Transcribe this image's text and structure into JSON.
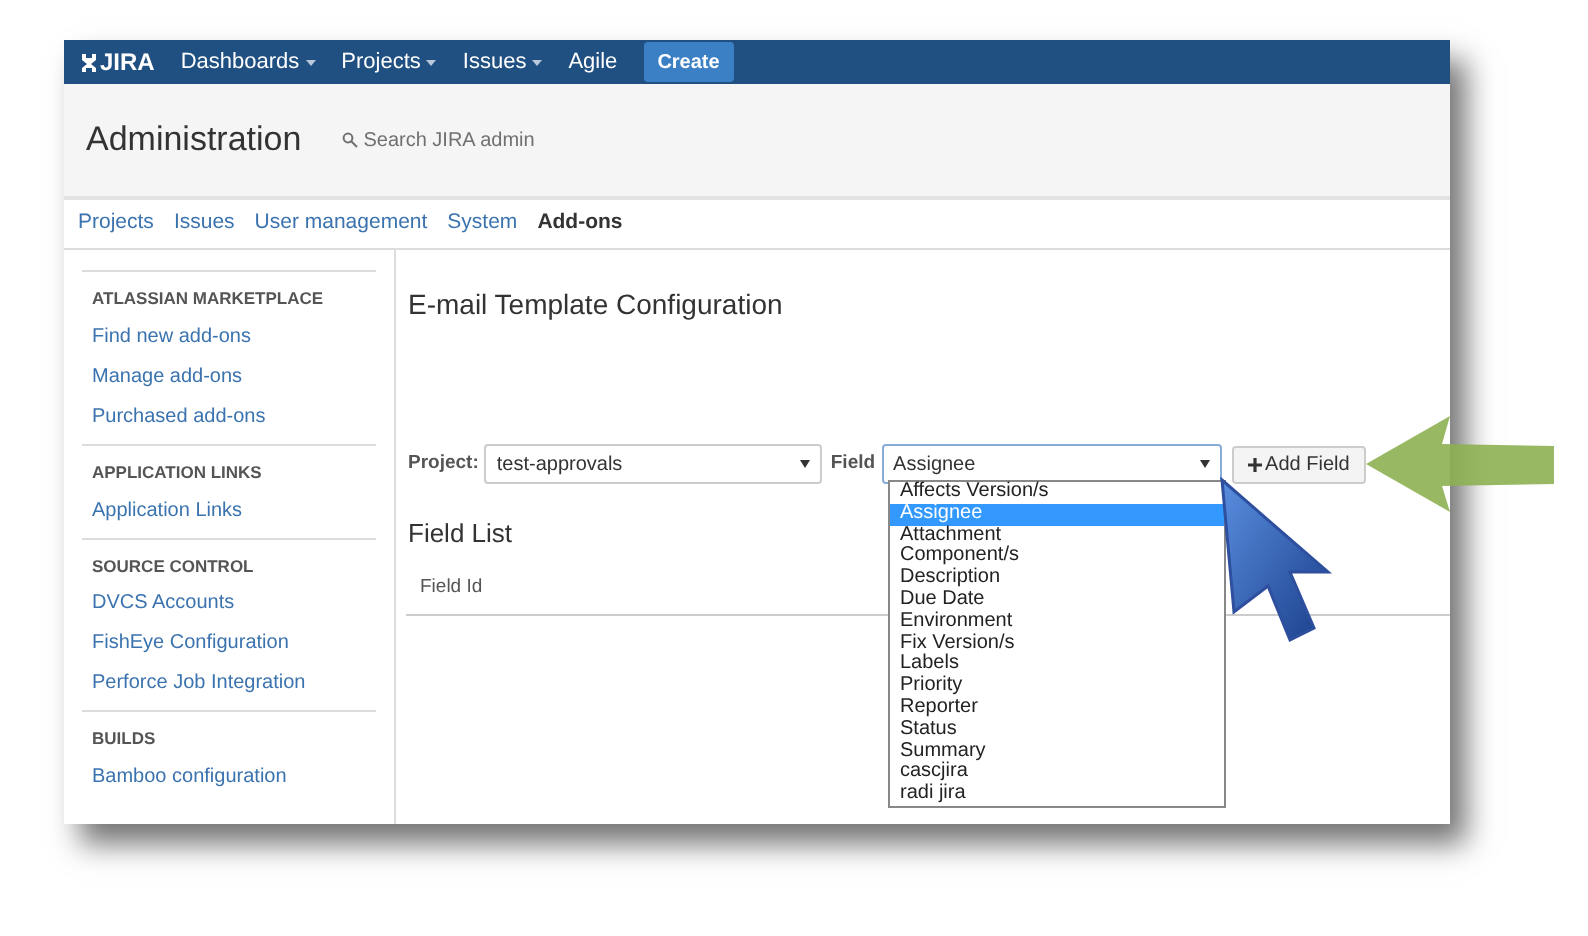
{
  "nav": {
    "logo": "JIRA",
    "items": [
      {
        "label": "Dashboards",
        "dropdown": true
      },
      {
        "label": "Projects",
        "dropdown": true
      },
      {
        "label": "Issues",
        "dropdown": true
      },
      {
        "label": "Agile",
        "dropdown": false
      }
    ],
    "create": "Create"
  },
  "header": {
    "title": "Administration",
    "search": {
      "placeholder": "Search JIRA admin"
    }
  },
  "admin_tabs": [
    {
      "label": "Projects",
      "selected": false
    },
    {
      "label": "Issues",
      "selected": false
    },
    {
      "label": "User management",
      "selected": false
    },
    {
      "label": "System",
      "selected": false
    },
    {
      "label": "Add-ons",
      "selected": true
    }
  ],
  "sidebar": [
    {
      "heading": "ATLASSIAN MARKETPLACE",
      "items": [
        "Find new add-ons",
        "Manage add-ons",
        "Purchased add-ons"
      ]
    },
    {
      "heading": "APPLICATION LINKS",
      "items": [
        "Application Links"
      ]
    },
    {
      "heading": "SOURCE CONTROL",
      "items": [
        "DVCS Accounts",
        "FishEye Configuration",
        "Perforce Job Integration"
      ]
    },
    {
      "heading": "BUILDS",
      "items": [
        "Bamboo configuration"
      ]
    }
  ],
  "main": {
    "title": "E-mail Template Configuration",
    "form": {
      "project_label": "Project:",
      "project_value": "test-approvals",
      "field_label": "Field",
      "field_value": "Assignee",
      "add_button": "Add Field",
      "options": [
        {
          "label": "Affects Version/s",
          "selected": false
        },
        {
          "label": "Assignee",
          "selected": true
        },
        {
          "label": "Attachment",
          "selected": false
        },
        {
          "label": "Component/s",
          "selected": false
        },
        {
          "label": "Description",
          "selected": false
        },
        {
          "label": "Due Date",
          "selected": false
        },
        {
          "label": "Environment",
          "selected": false
        },
        {
          "label": "Fix Version/s",
          "selected": false
        },
        {
          "label": "Labels",
          "selected": false
        },
        {
          "label": "Priority",
          "selected": false
        },
        {
          "label": "Reporter",
          "selected": false
        },
        {
          "label": "Status",
          "selected": false
        },
        {
          "label": "Summary",
          "selected": false
        },
        {
          "label": "cascjira",
          "selected": false
        },
        {
          "label": "radi jira",
          "selected": false
        }
      ]
    },
    "field_list": {
      "title": "Field List",
      "columns": [
        "Field Id"
      ]
    }
  }
}
